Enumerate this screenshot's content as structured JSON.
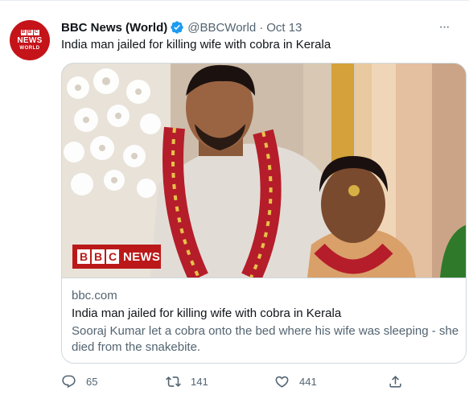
{
  "tweet": {
    "avatar_letters": [
      "B",
      "B",
      "C"
    ],
    "avatar_news": "NEWS",
    "avatar_world": "WORLD",
    "author_name": "BBC News (World)",
    "handle": "@BBCWorld",
    "separator": "·",
    "timestamp": "Oct 13",
    "text": "India man jailed for killing wife with cobra in Kerala",
    "more_label": "···"
  },
  "card": {
    "badge_letters": [
      "B",
      "B",
      "C"
    ],
    "badge_news": "NEWS",
    "domain": "bbc.com",
    "title": "India man jailed for killing wife with cobra in Kerala",
    "description": "Sooraj Kumar let a cobra onto the bed where his wife was sleeping - she died from the snakebite."
  },
  "actions": {
    "replies": "65",
    "retweets": "141",
    "likes": "441"
  },
  "colors": {
    "bbc_red": "#bb1919",
    "verified_blue": "#1d9bf0",
    "secondary_text": "#536471"
  }
}
